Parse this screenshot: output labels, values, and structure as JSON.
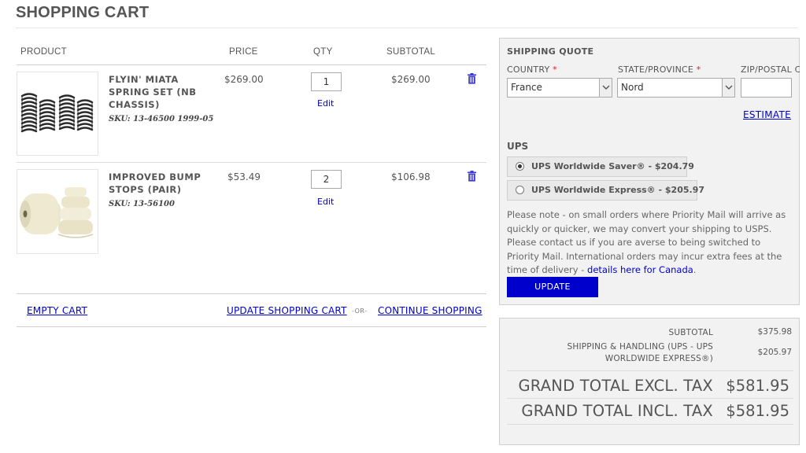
{
  "page": {
    "title": "SHOPPING CART"
  },
  "cart": {
    "headers": {
      "product": "PRODUCT",
      "price": "PRICE",
      "qty": "QTY",
      "subtotal": "SUBTOTAL"
    },
    "items": [
      {
        "name": "FLYIN' MIATA SPRING SET (NB CHASSIS)",
        "sku": "SKU: 13-46500 1999-05",
        "price": "$269.00",
        "qty": "1",
        "subtotal": "$269.00",
        "edit_label": "Edit"
      },
      {
        "name": "IMPROVED BUMP STOPS (PAIR)",
        "sku": "SKU: 13-56100",
        "price": "$53.49",
        "qty": "2",
        "subtotal": "$106.98",
        "edit_label": "Edit"
      }
    ],
    "actions": {
      "empty": "EMPTY CART",
      "update": "UPDATE SHOPPING CART",
      "or": "-OR-",
      "continue": "CONTINUE SHOPPING"
    }
  },
  "shipping_quote": {
    "title": "SHIPPING QUOTE",
    "country_label": "COUNTRY",
    "country_value": "France",
    "state_label": "STATE/PROVINCE",
    "state_value": "Nord",
    "zip_label": "ZIP/POSTAL CODE",
    "zip_value": "",
    "required_mark": "*",
    "estimate_label": "ESTIMATE",
    "carrier": "UPS",
    "options": [
      {
        "label": "UPS Worldwide Saver® - $204.79",
        "selected": true
      },
      {
        "label": "UPS Worldwide Express® - $205.97",
        "selected": false
      }
    ],
    "note_text": "Please note - on small orders where Priority Mail will arrive as quickly or quicker, we may convert your shipping to USPS. Please contact us if you are averse to being switched to Priority Mail. International orders may incur extra fees at the time of delivery - ",
    "note_link": "details here for Canada",
    "note_end": ".",
    "update_label": "UPDATE"
  },
  "totals": {
    "subtotal_label": "SUBTOTAL",
    "subtotal_value": "$375.98",
    "shipping_label": "SHIPPING & HANDLING (UPS - UPS WORLDWIDE EXPRESS®)",
    "shipping_value": "$205.97",
    "grand_excl_label": "GRAND TOTAL EXCL. TAX",
    "grand_excl_value": "$581.95",
    "grand_incl_label": "GRAND TOTAL INCL. TAX",
    "grand_incl_value": "$581.95"
  },
  "colors": {
    "link": "#0000cc",
    "button": "#0000cc",
    "required": "#e01b1b"
  },
  "icons": [
    "trash-icon",
    "radio-icon",
    "select-caret-icon",
    "spring-set-image",
    "bump-stops-image"
  ]
}
